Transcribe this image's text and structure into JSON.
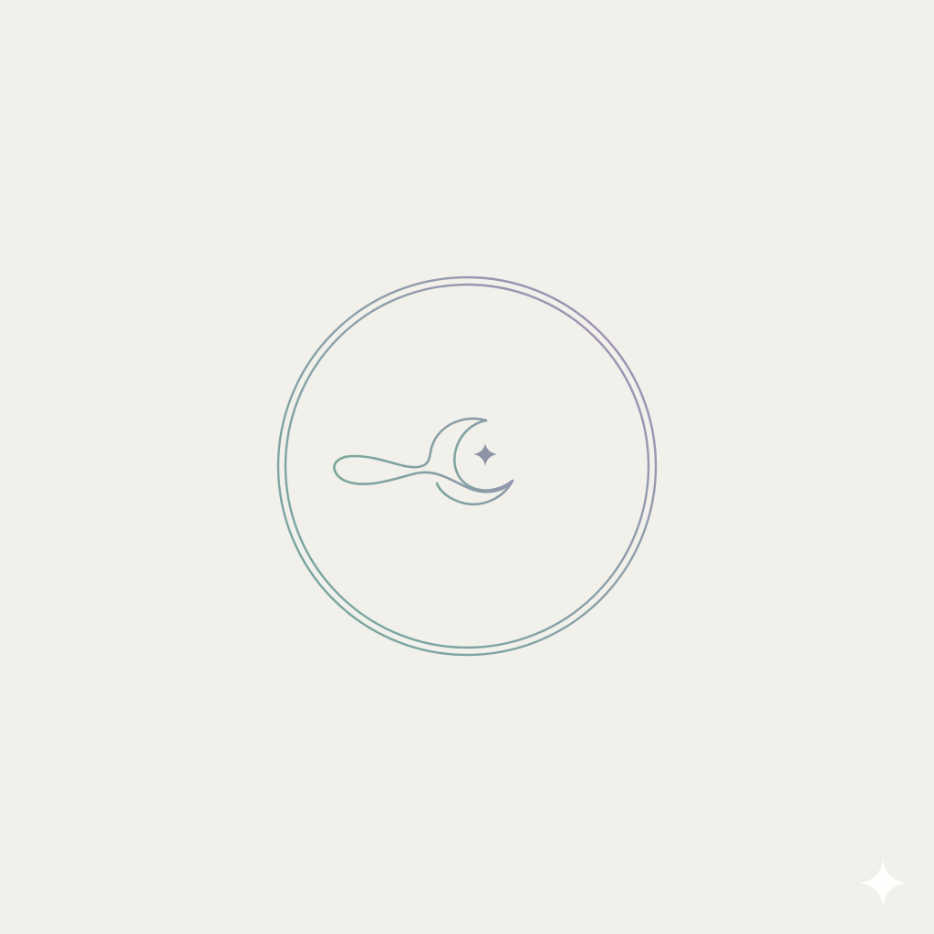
{
  "emblem": {
    "name": "circle-moon-star-emblem",
    "elements": [
      "outer-ring",
      "inner-ring",
      "flowing-wave",
      "crescent-moon",
      "four-point-star"
    ]
  },
  "colors": {
    "background": "#f1f0eb",
    "ring_gradient_start": "#72a89a",
    "ring_gradient_mid": "#8ea0aa",
    "ring_gradient_end": "#a18db5",
    "motif_gradient_start": "#7aa89c",
    "motif_gradient_end": "#9297ad",
    "star_fill": "#8f93a8",
    "corner_sparkle": "#ffffff"
  },
  "icons": {
    "center_motif": "moon-wave-star-icon",
    "corner": "sparkle-icon"
  }
}
